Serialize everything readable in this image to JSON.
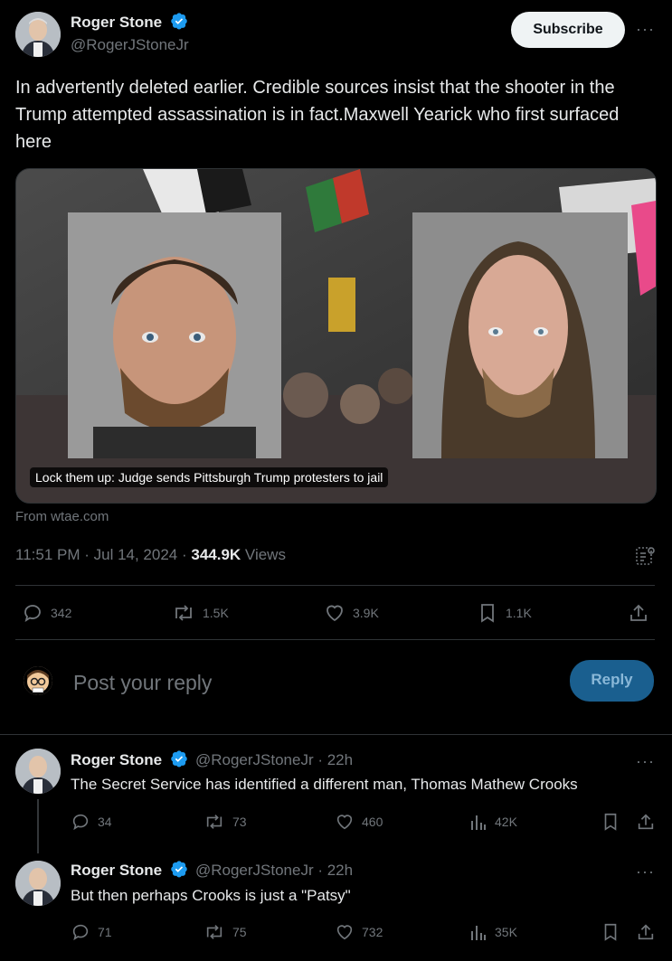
{
  "tweet": {
    "author_name": "Roger Stone",
    "author_handle": "@RogerJStoneJr",
    "subscribe_label": "Subscribe",
    "more_label": "···",
    "text": "In advertently deleted earlier. Credible sources insist that the shooter in the Trump attempted assassination is in fact.Maxwell Yearick who first surfaced here",
    "media_caption": "Lock them up: Judge sends Pittsburgh Trump protesters to jail",
    "source": "From wtae.com",
    "timestamp": "11:51 PM · Jul 14, 2024 · ",
    "views_count": "344.9K",
    "views_label": " Views",
    "actions": {
      "replies": "342",
      "reposts": "1.5K",
      "likes": "3.9K",
      "bookmarks": "1.1K"
    }
  },
  "composer": {
    "placeholder": "Post your reply",
    "reply_label": "Reply"
  },
  "replies": [
    {
      "author_name": "Roger Stone",
      "author_handle": "@RogerJStoneJr · 22h",
      "text": "The Secret Service has identified a different man, Thomas Mathew Crooks",
      "replies": "34",
      "reposts": "73",
      "likes": "460",
      "views": "42K"
    },
    {
      "author_name": "Roger Stone",
      "author_handle": "@RogerJStoneJr · 22h",
      "text": "But then perhaps Crooks is just a \"Patsy\"",
      "replies": "71",
      "reposts": "75",
      "likes": "732",
      "views": "35K"
    }
  ],
  "colors": {
    "background": "#000000",
    "text": "#e7e9ea",
    "muted": "#71767b",
    "verified": "#1d9bf0",
    "reply_button": "#1a5f8f"
  }
}
